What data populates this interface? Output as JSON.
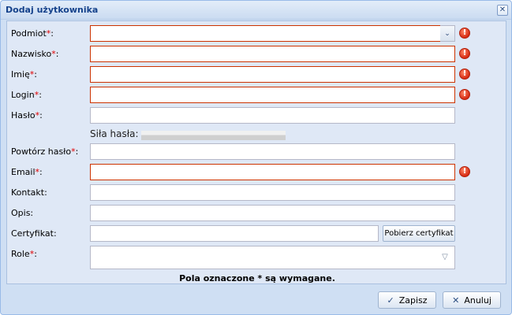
{
  "dialog": {
    "title": "Dodaj użytkownika",
    "close_glyph": "✕"
  },
  "form": {
    "required_marker": "*",
    "fields": {
      "podmiot": {
        "label": "Podmiot",
        "suffix": ":",
        "value": "",
        "required": true,
        "invalid": true
      },
      "nazwisko": {
        "label": "Nazwisko",
        "suffix": ":",
        "value": "",
        "required": true,
        "invalid": true
      },
      "imie": {
        "label": "Imię",
        "suffix": ":",
        "value": "",
        "required": true,
        "invalid": true
      },
      "login": {
        "label": "Login",
        "suffix": ":",
        "value": "",
        "required": true,
        "invalid": true
      },
      "haslo": {
        "label": "Hasło",
        "suffix": ":",
        "value": "",
        "required": true,
        "invalid": false
      },
      "powtorz_haslo": {
        "label": "Powtórz hasło",
        "suffix": ":",
        "value": "",
        "required": true,
        "invalid": false
      },
      "email": {
        "label": "Email",
        "suffix": ":",
        "value": "",
        "required": true,
        "invalid": true
      },
      "kontakt": {
        "label": "Kontakt:",
        "value": ""
      },
      "opis": {
        "label": "Opis:",
        "value": ""
      },
      "certyfikat": {
        "label": "Certyfikat:",
        "value": "",
        "button_label": "Pobierz certyfikat"
      },
      "role": {
        "label": "Role",
        "suffix": ":",
        "value": "",
        "required": true
      }
    },
    "password_strength": {
      "label": "Siła hasła:",
      "level": 0
    },
    "required_note": "Pola oznaczone * są wymagane."
  },
  "buttons": {
    "save_label": "Zapisz",
    "cancel_label": "Anuluj"
  },
  "icons": {
    "error_icon": "!",
    "combo_trigger": "⌄",
    "roles_trigger": "▽",
    "check_icon": "✓",
    "cancel_icon": "✕"
  },
  "colors": {
    "required_star": "#e00000",
    "invalid_border": "#cc3300",
    "title_text": "#15428b"
  }
}
